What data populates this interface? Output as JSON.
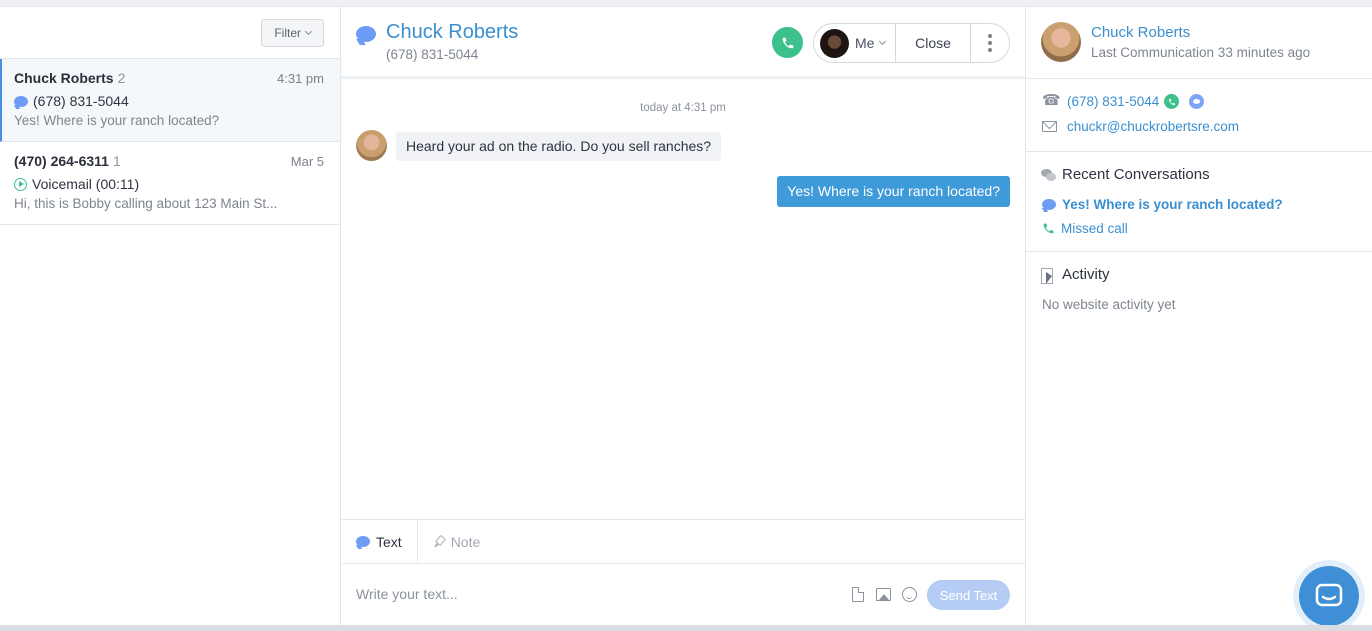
{
  "left": {
    "filter_label": "Filter",
    "conversations": [
      {
        "name": "Chuck Roberts",
        "count": "2",
        "time": "4:31 pm",
        "channel": "(678) 831-5044",
        "preview": "Yes! Where is your ranch located?"
      },
      {
        "name": "(470) 264-6311",
        "count": "1",
        "time": "Mar 5",
        "channel": "Voicemail (00:11)",
        "preview": "Hi, this is Bobby calling about 123 Main St..."
      }
    ]
  },
  "header": {
    "contact_name": "Chuck Roberts",
    "contact_phone": "(678) 831-5044",
    "assignee_label": "Me",
    "close_label": "Close"
  },
  "thread": {
    "day_label": "today at 4:31 pm",
    "messages": [
      {
        "direction": "in",
        "text": "Heard your ad on the radio. Do you sell ranches?"
      },
      {
        "direction": "out",
        "text": "Yes! Where is your ranch located?"
      }
    ]
  },
  "composer": {
    "tabs": [
      {
        "label": "Text"
      },
      {
        "label": "Note"
      }
    ],
    "placeholder": "Write your text...",
    "send_label": "Send Text"
  },
  "contact_panel": {
    "name": "Chuck Roberts",
    "last_communication": "Last Communication 33 minutes ago",
    "phone": "(678) 831-5044",
    "email": "chuckr@chuckrobertsre.com",
    "recent_title": "Recent Conversations",
    "recent": [
      {
        "label": "Yes! Where is your ranch located?",
        "kind": "text"
      },
      {
        "label": "Missed call",
        "kind": "call"
      }
    ],
    "activity_title": "Activity",
    "activity_empty": "No website activity yet"
  },
  "colors": {
    "accent": "#3a8fd0",
    "outgoing_bubble": "#3e9ad8",
    "call_green": "#3cc08c",
    "text_bubble_icon": "#6c9cf4"
  }
}
